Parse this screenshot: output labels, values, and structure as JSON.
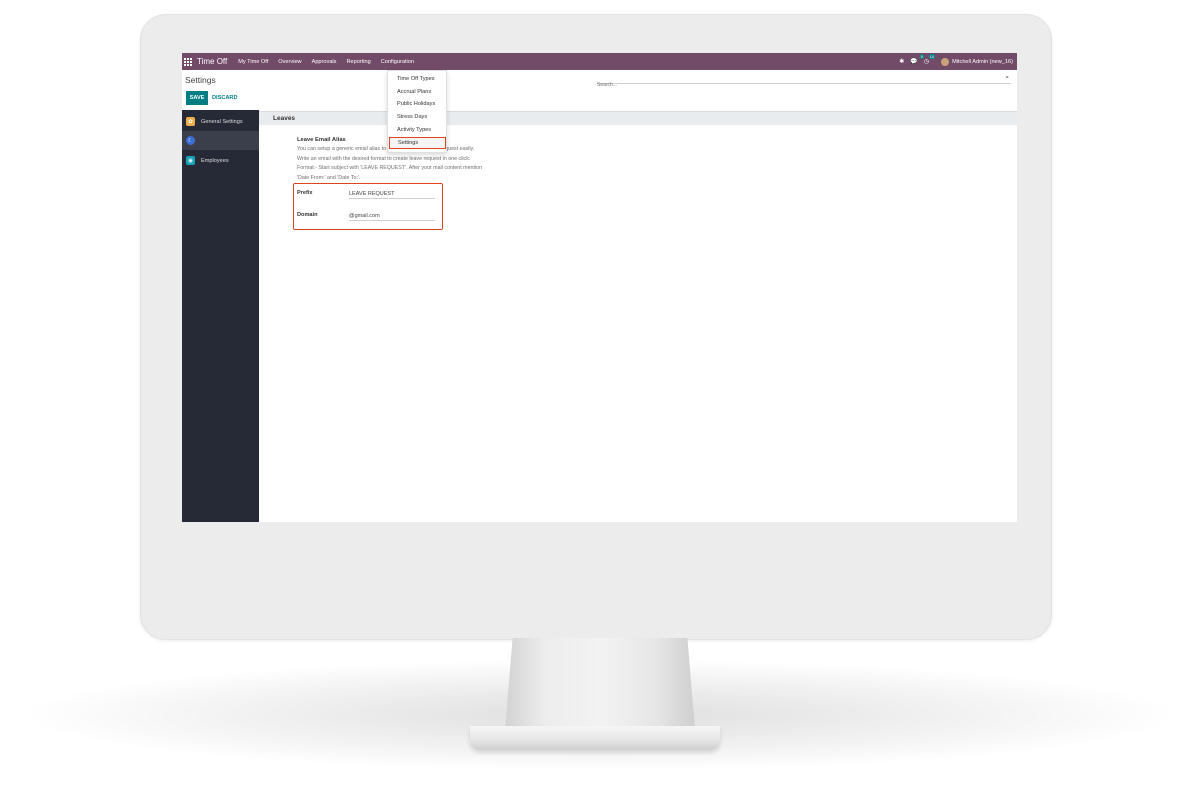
{
  "navbar": {
    "app_name": "Time Off",
    "menu": [
      "My Time Off",
      "Overview",
      "Approvals",
      "Reporting",
      "Configuration"
    ],
    "messages_count": "5",
    "activities_count": "10",
    "user": "Mitchell Admin (new_16)"
  },
  "control_panel": {
    "title": "Settings",
    "save_label": "SAVE",
    "discard_label": "DISCARD",
    "search_placeholder": "Search..."
  },
  "sidebar": {
    "items": [
      {
        "label": "General Settings",
        "icon": "gear-icon",
        "color": "#f0ad4e"
      },
      {
        "label": "",
        "icon": "time-off-icon",
        "color": "#3a6fd8"
      },
      {
        "label": "Employees",
        "icon": "employees-icon",
        "color": "#17a2b8"
      }
    ]
  },
  "configuration_menu": {
    "items": [
      "Time Off Types",
      "Accrual Plans",
      "Public Holidays",
      "Stress Days",
      "Activity Types",
      "Settings"
    ],
    "active": "Settings"
  },
  "main": {
    "section_title": "Leaves",
    "setting_title": "Leave Email Alias",
    "setting_description": "You can setup a generic email alias to create incoming leave request easily. Write an email with the desired format to create leave request in one click. Format:- Start subject with 'LEAVE REQUEST'. After your mail content mention 'Date From:' and 'Date To:'.",
    "prefix_label": "Prefix",
    "prefix_value": "LEAVE REQUEST",
    "domain_label": "Domain",
    "domain_value": "@gmail.com"
  },
  "colors": {
    "navbar": "#714b67",
    "primary": "#017e84",
    "highlight": "#e0441d",
    "sidebar": "#262a36"
  }
}
